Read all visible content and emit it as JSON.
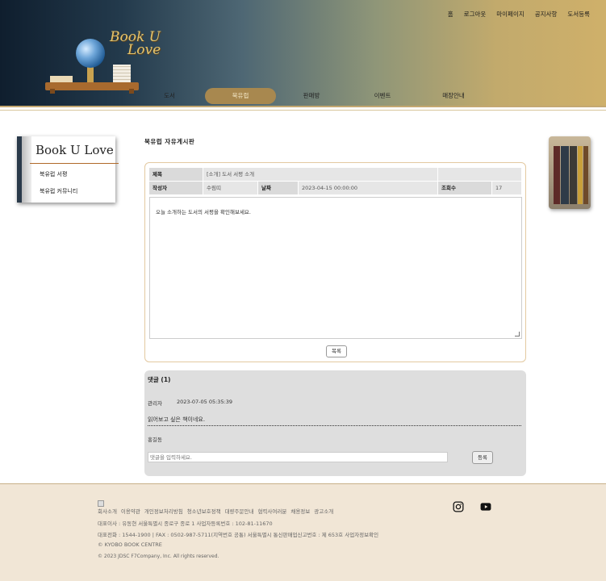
{
  "header": {
    "top_links": [
      "홈",
      "로그아웃",
      "마이페이지",
      "공지사항",
      "도서등록"
    ],
    "logo": {
      "line1": "Book U",
      "line2": "Love"
    },
    "nav": [
      "도서",
      "북유럽",
      "판매방",
      "이벤트",
      "매장안내"
    ],
    "nav_active_index": 1
  },
  "sidebar": {
    "title": "Book U Love",
    "items": [
      "북유럽 서평",
      "북유럽 커뮤니티"
    ]
  },
  "board": {
    "title": "북유럽 자유게시판",
    "labels": {
      "subject": "제목",
      "author": "작성자",
      "date": "날짜",
      "views": "조회수"
    },
    "post": {
      "subject": "[소개] 도서 서평 소개",
      "author": "수림띠",
      "date": "2023-04-15 00:00:00",
      "views": "17",
      "content": "오늘 소개하는 도서의 서평을 확인해보세요."
    },
    "list_button": "목록"
  },
  "comments": {
    "header": "댓글 (1)",
    "items": [
      {
        "author": "관리자",
        "date": "2023-07-05 05:35:39",
        "text": "읽어보고 싶은 책이네요."
      }
    ],
    "current_user": "홍길동",
    "input_placeholder": "댓글을 입력하세요.",
    "submit": "등록"
  },
  "footer": {
    "links": [
      "회사소개",
      "이용약관",
      "개인정보처리방침",
      "청소년보호정책",
      "대량주문안내",
      "협력사여러분",
      "채용정보",
      "광고소개"
    ],
    "line1": "대표이사 : 유동현 서울특별시 종로구 종로 1 사업자등록번호 : 102-81-11670",
    "line2": "대표전화 : 1544-1900 | FAX : 0502-987-5711(지역번호 공통) 서울특별시 통신판매업신고번호 : 제 653호 사업자정보확인",
    "line3": "© KYOBO BOOK CENTRE",
    "line4": "© 2023 JDSC F7Company, Inc. All rights reserved.",
    "icons": [
      "instagram-icon",
      "youtube-icon"
    ]
  },
  "colors": {
    "header_gradient_start": "#0f1e2e",
    "header_gradient_end": "#cfb06a",
    "nav_active": "#a8884f",
    "footer_bg": "#f1e6d6",
    "post_border": "#e3c9a0"
  }
}
